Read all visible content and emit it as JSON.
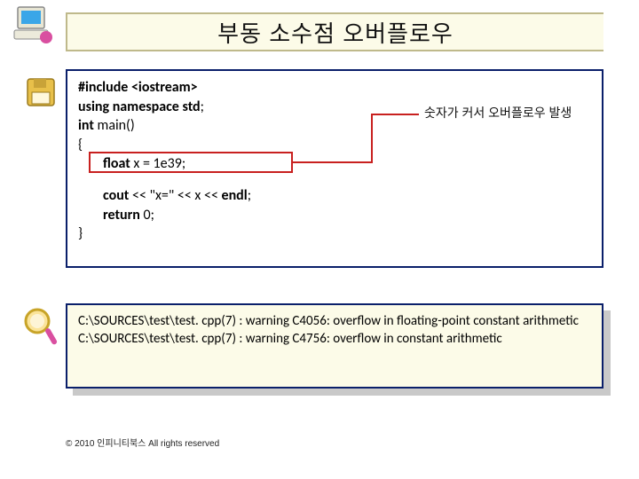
{
  "title": "부동 소수점 오버플로우",
  "code": {
    "l1a": "#include <iostream>",
    "l2a": "using namespace ",
    "l2b": "std",
    "l2c": ";",
    "l3a": "int ",
    "l3b": "main()",
    "l4": "{",
    "l5a": "float ",
    "l5b": "x = 1e39;",
    "l6a": "cout",
    "l6b": " << \"x=\" << x << ",
    "l6c": "endl",
    "l6d": ";",
    "l7a": "return ",
    "l7b": "0;",
    "l8": "}"
  },
  "callout": "숫자가 커서 오버플로우 발생",
  "warnings": {
    "w1": "C:\\SOURCES\\test\\test. cpp(7) : warning C4056: overflow in floating-point constant arithmetic",
    "w2": "C:\\SOURCES\\test\\test. cpp(7) : warning C4756: overflow in constant arithmetic"
  },
  "footer": "© 2010 인피니티북스  All rights reserved"
}
